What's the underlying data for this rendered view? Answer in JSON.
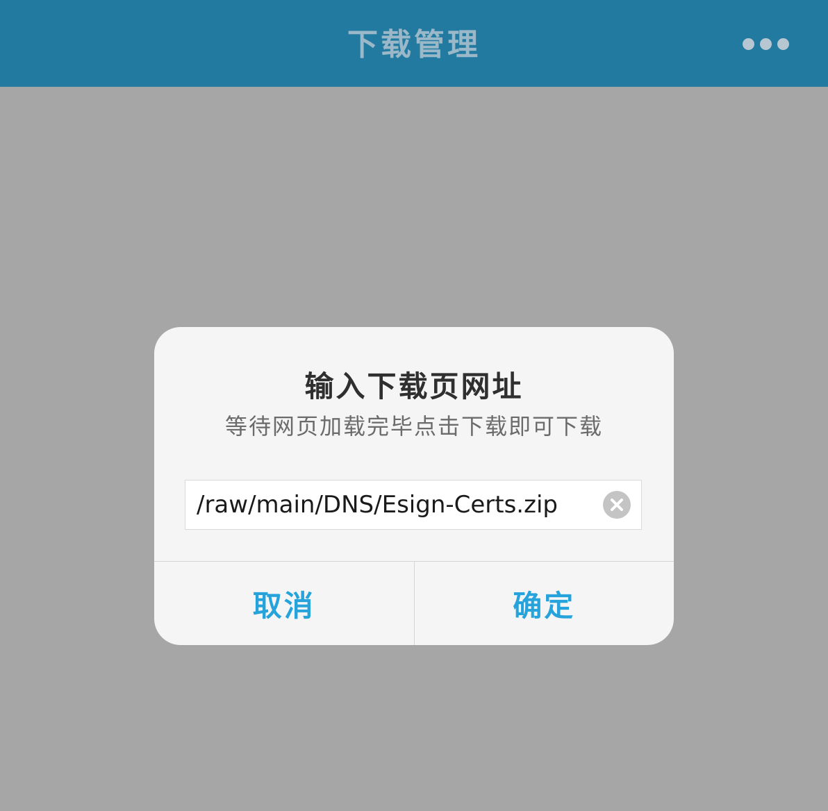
{
  "navbar": {
    "title": "下载管理",
    "more_icon": "more-horizontal-icon"
  },
  "dialog": {
    "title": "输入下载页网址",
    "subtitle": "等待网页加载完毕点击下载即可下载",
    "url_value": "/raw/main/DNS/Esign-Certs.zip",
    "clear_icon": "clear-icon",
    "cancel_label": "取消",
    "confirm_label": "确定"
  },
  "colors": {
    "navbar_bg": "#237aa0",
    "overlay_bg": "#a6a6a6",
    "dialog_bg": "#f5f5f5",
    "accent": "#27a3dc"
  }
}
